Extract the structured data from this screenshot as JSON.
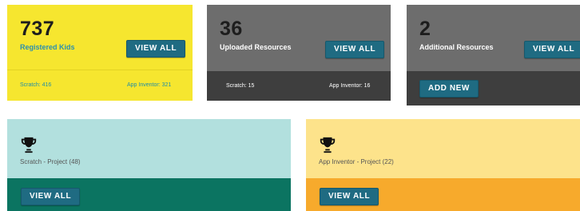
{
  "stats": [
    {
      "number": "737",
      "label": "Registered Kids",
      "button": "VIEW ALL",
      "footer_left": "Scratch: 416",
      "footer_right": "App Inventor: 321"
    },
    {
      "number": "36",
      "label": "Uploaded Resources",
      "button": "VIEW ALL",
      "footer_left": "Scratch: 15",
      "footer_right": "App Inventor: 16"
    },
    {
      "number": "2",
      "label": "Additional Resources",
      "button": "VIEW ALL",
      "footer_button": "ADD NEW"
    }
  ],
  "projects": [
    {
      "label": "Scratch - Project (48)",
      "button": "VIEW ALL",
      "icon": "trophy-icon"
    },
    {
      "label": "App Inventor - Project (22)",
      "button": "VIEW ALL",
      "icon": "trophy-icon"
    }
  ],
  "colors": {
    "yellow": "#f6e62f",
    "grey": "#6d6d6d",
    "dark_grey": "#3e3e3e",
    "button": "#1f6b82",
    "teal_light": "#b2e0de",
    "teal_dark": "#0b7461",
    "orange_light": "#fde38b",
    "orange": "#f7aa2c"
  }
}
